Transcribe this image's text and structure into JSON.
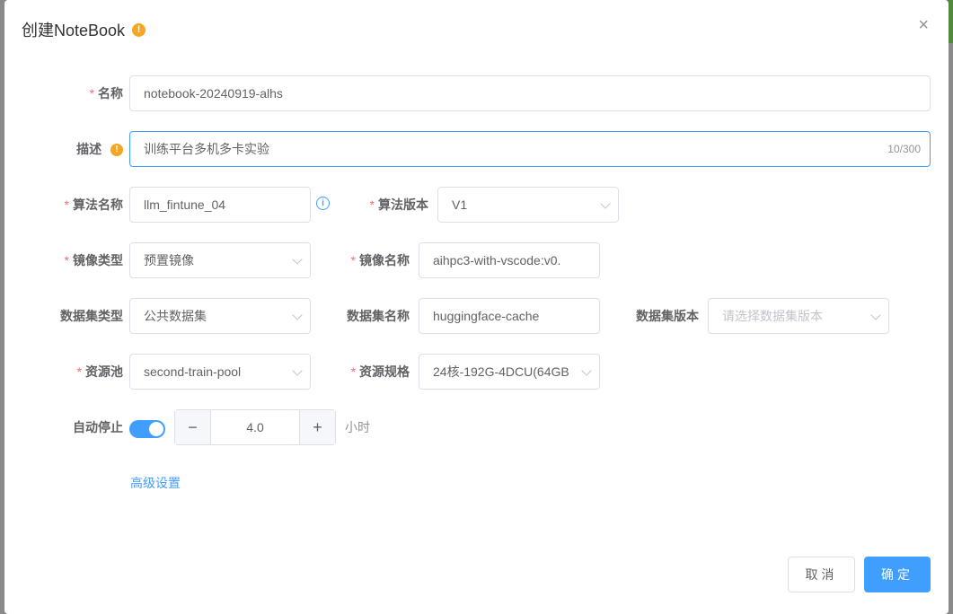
{
  "dialog": {
    "title": "创建NoteBook",
    "title_warn_icon": "exclamation-icon",
    "close_glyph": "×"
  },
  "form": {
    "required_mark": "*",
    "name": {
      "label": "名称",
      "value": "notebook-20240919-alhs"
    },
    "description": {
      "label": "描述",
      "value": "训练平台多机多卡实验",
      "count": "10/300",
      "label_icon": "exclamation-icon"
    },
    "algo_name": {
      "label": "算法名称",
      "value": "llm_fintune_04",
      "info_icon": "info-icon"
    },
    "algo_version": {
      "label": "算法版本",
      "value": "V1"
    },
    "image_type": {
      "label": "镜像类型",
      "value": "预置镜像"
    },
    "image_name": {
      "label": "镜像名称",
      "value": "aihpc3-with-vscode:v0."
    },
    "dataset_type": {
      "label": "数据集类型",
      "value": "公共数据集"
    },
    "dataset_name": {
      "label": "数据集名称",
      "value": "huggingface-cache"
    },
    "dataset_version": {
      "label": "数据集版本",
      "placeholder": "请选择数据集版本"
    },
    "resource_pool": {
      "label": "资源池",
      "value": "second-train-pool"
    },
    "resource_spec": {
      "label": "资源规格",
      "value": "24核-192G-4DCU(64GB"
    },
    "auto_stop": {
      "label": "自动停止",
      "enabled": true,
      "value": "4.0",
      "unit": "小时",
      "minus": "−",
      "plus": "+"
    },
    "advanced_link": "高级设置"
  },
  "footer": {
    "cancel_label": "取消",
    "ok_label": "确定"
  },
  "colors": {
    "accent": "#409eff",
    "required": "#f56c6c",
    "warning": "#f5a623"
  }
}
